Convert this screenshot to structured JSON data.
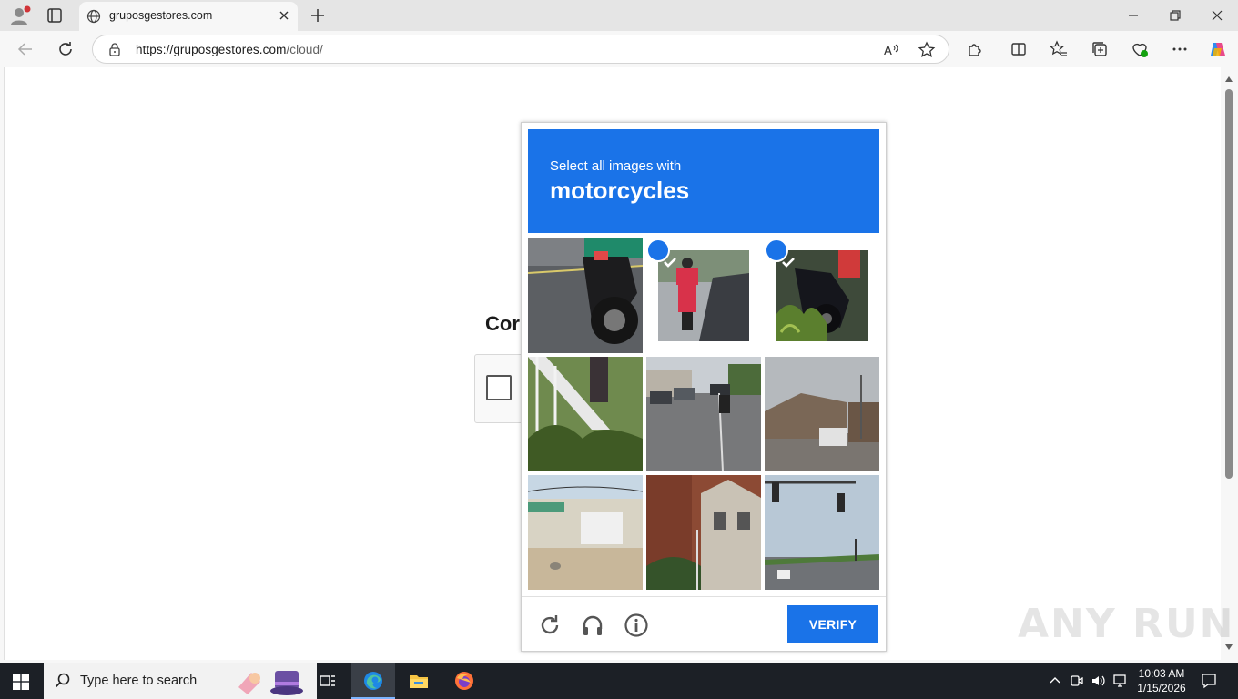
{
  "browser": {
    "tab_title": "gruposgestores.com",
    "url_host": "https://gruposgestores.com",
    "url_path": "/cloud/"
  },
  "page": {
    "heading_partial": "Cor"
  },
  "captcha": {
    "instruction": "Select all images with",
    "target": "motorcycles",
    "tiles": [
      {
        "name": "motorcycle-rear-closeup",
        "selected": false
      },
      {
        "name": "delivery-scooter",
        "selected": true
      },
      {
        "name": "motorcycle-plants",
        "selected": true
      },
      {
        "name": "house-stairs",
        "selected": false
      },
      {
        "name": "street-motorcyclist",
        "selected": false
      },
      {
        "name": "building-cloudy",
        "selected": false
      },
      {
        "name": "storefront",
        "selected": false
      },
      {
        "name": "brick-house",
        "selected": false
      },
      {
        "name": "traffic-light",
        "selected": false
      }
    ],
    "verify_label": "VERIFY",
    "colors": {
      "accent": "#1a73e8"
    }
  },
  "watermark": "ANY RUN",
  "taskbar": {
    "search_placeholder": "Type here to search",
    "time": "10:03 AM",
    "date": "1/15/2026"
  }
}
